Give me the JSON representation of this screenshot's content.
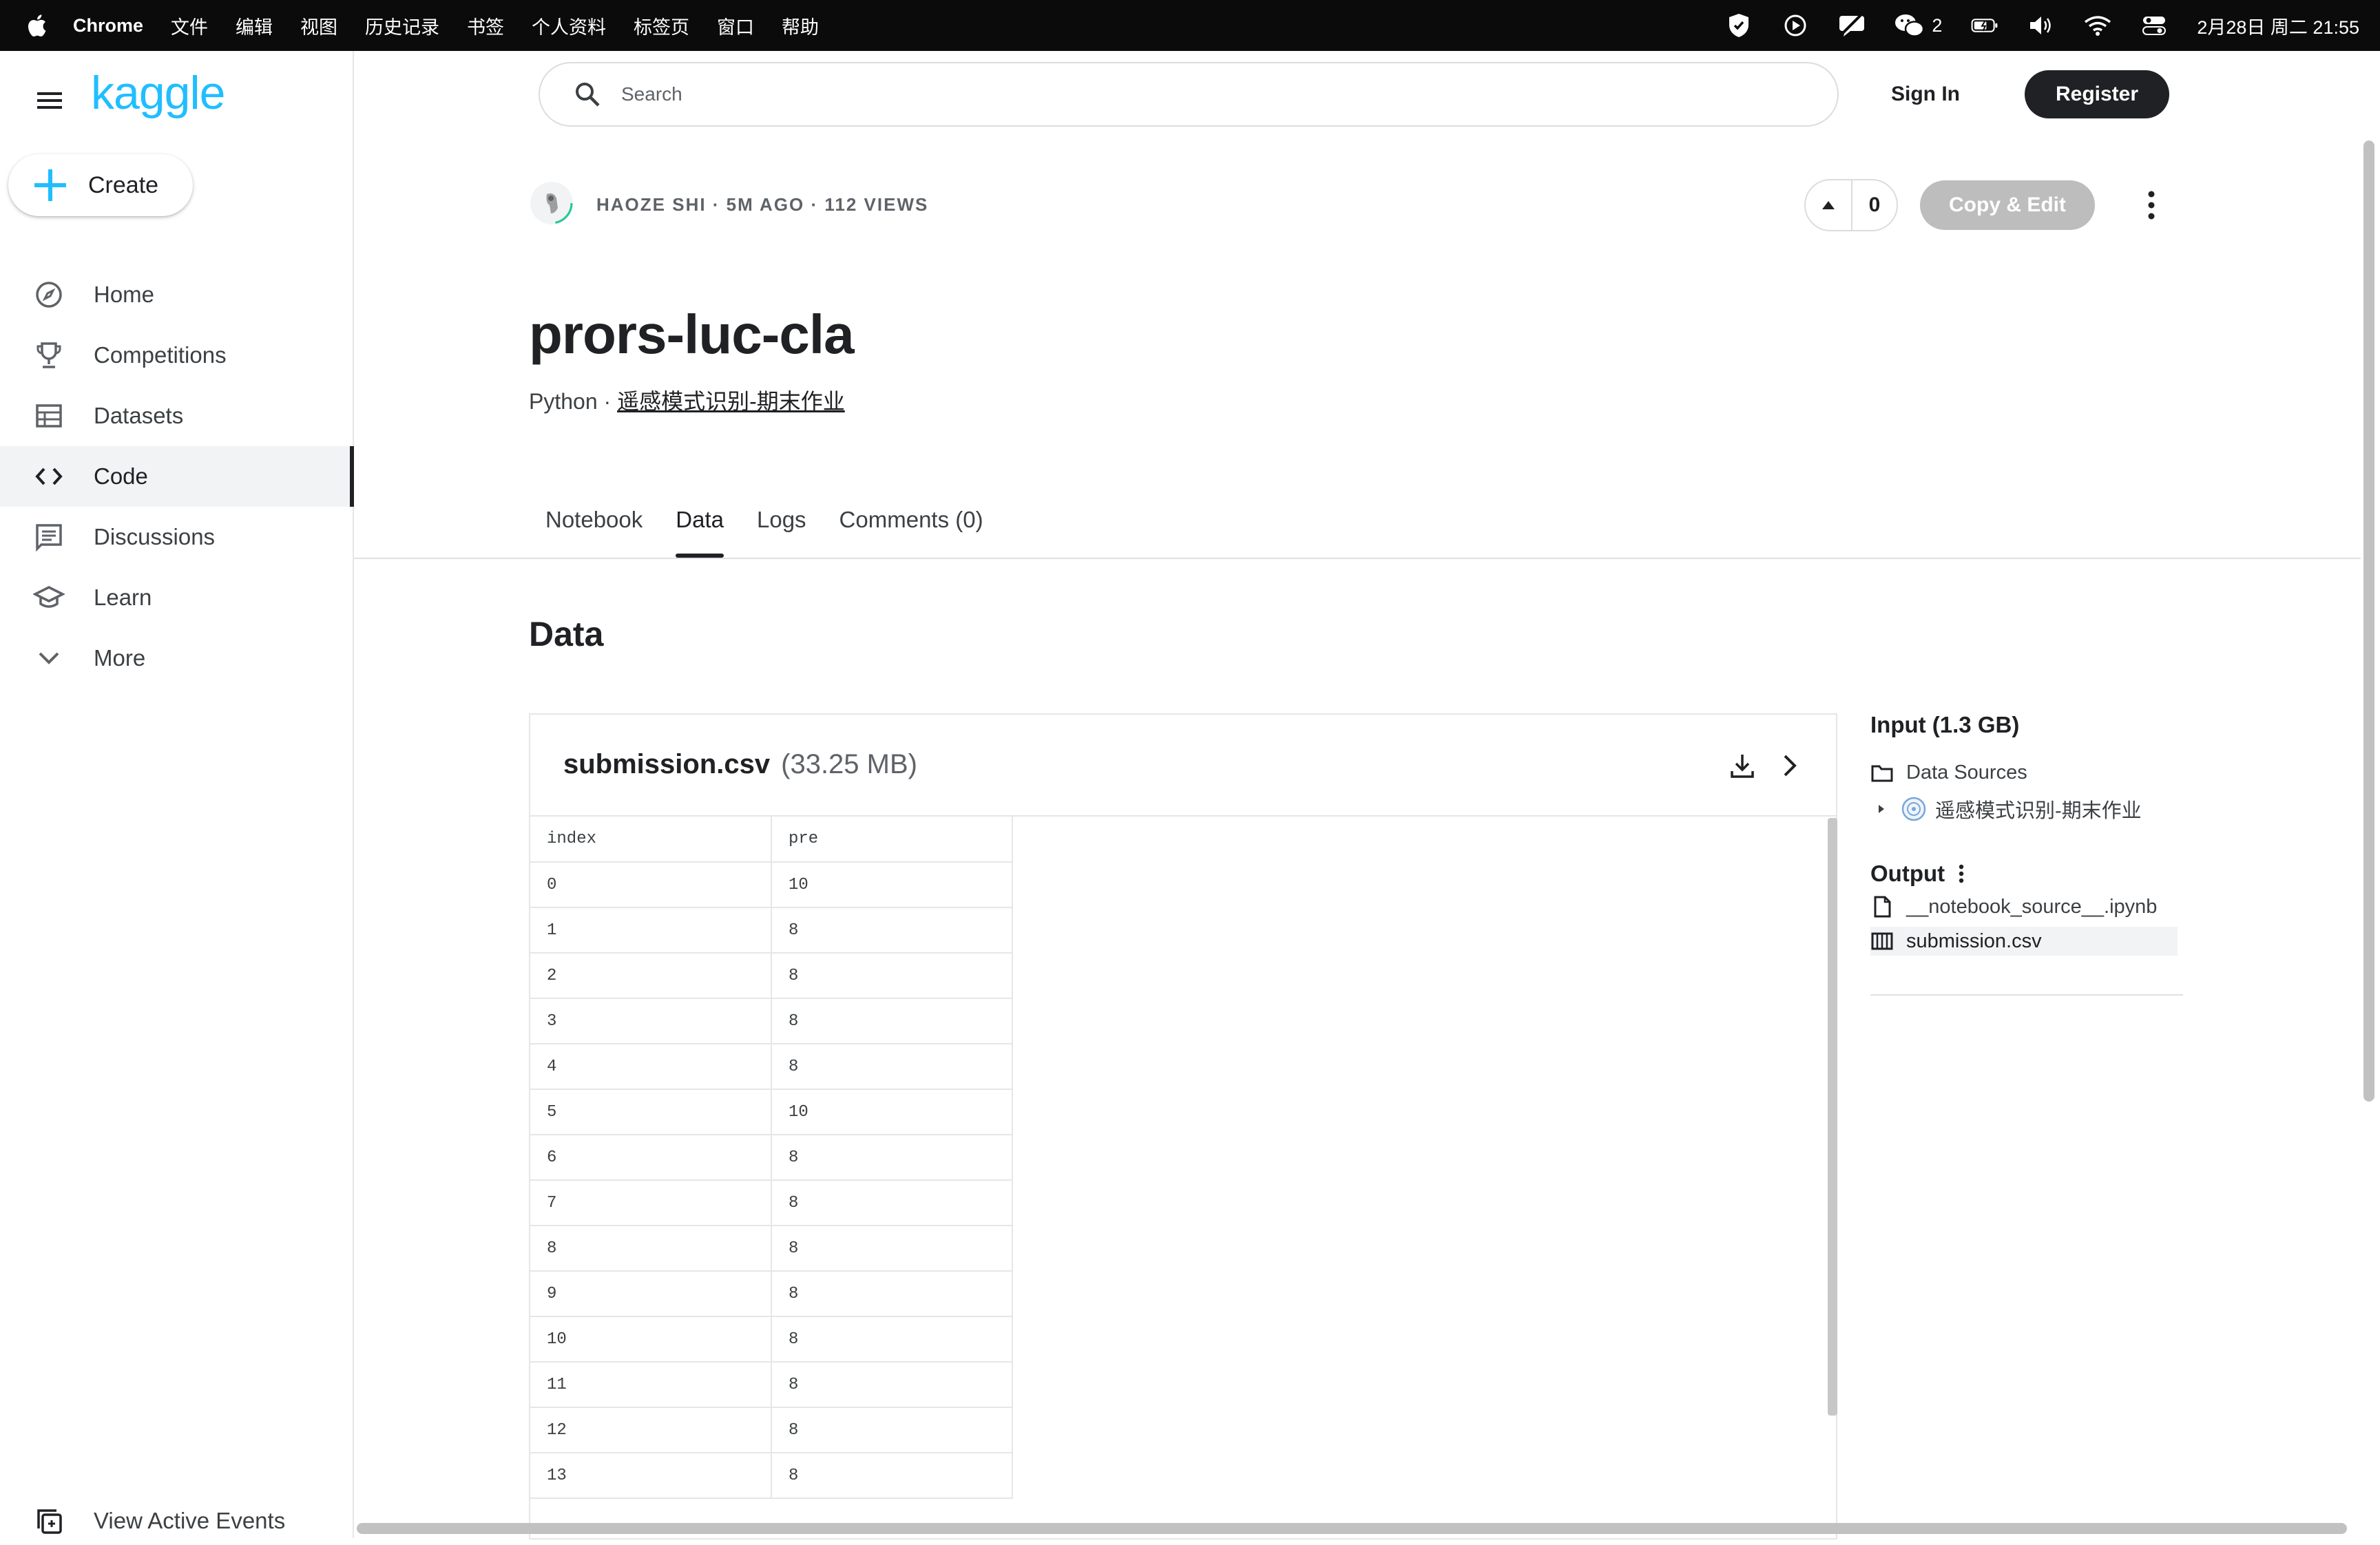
{
  "menubar": {
    "app": "Chrome",
    "items": [
      "文件",
      "编辑",
      "视图",
      "历史记录",
      "书签",
      "个人资料",
      "标签页",
      "窗口",
      "帮助"
    ],
    "wechat_count": "2",
    "datetime": "2月28日 周二 21:55"
  },
  "sidebar": {
    "logo": "kaggle",
    "create_label": "Create",
    "items": [
      {
        "label": "Home",
        "icon": "compass-icon"
      },
      {
        "label": "Competitions",
        "icon": "trophy-icon"
      },
      {
        "label": "Datasets",
        "icon": "table-icon"
      },
      {
        "label": "Code",
        "icon": "code-icon",
        "active": true
      },
      {
        "label": "Discussions",
        "icon": "discussion-icon"
      },
      {
        "label": "Learn",
        "icon": "school-icon"
      },
      {
        "label": "More",
        "icon": "chevron-down-icon"
      }
    ],
    "view_events": "View Active Events"
  },
  "header": {
    "search_placeholder": "Search",
    "sign_in": "Sign In",
    "register": "Register"
  },
  "notebook": {
    "meta": "HAOZE SHI · 5M AGO · 112 VIEWS",
    "votes": "0",
    "copy_edit": "Copy & Edit",
    "title": "prors-luc-cla",
    "language": "Python · ",
    "competition": "遥感模式识别-期末作业",
    "tabs": [
      "Notebook",
      "Data",
      "Logs",
      "Comments (0)"
    ],
    "active_tab": "Data"
  },
  "data": {
    "heading": "Data",
    "file_name": "submission.csv",
    "file_size": "(33.25 MB)",
    "columns": [
      "index",
      "pre"
    ],
    "rows": [
      [
        "0",
        "10"
      ],
      [
        "1",
        "8"
      ],
      [
        "2",
        "8"
      ],
      [
        "3",
        "8"
      ],
      [
        "4",
        "8"
      ],
      [
        "5",
        "10"
      ],
      [
        "6",
        "8"
      ],
      [
        "7",
        "8"
      ],
      [
        "8",
        "8"
      ],
      [
        "9",
        "8"
      ],
      [
        "10",
        "8"
      ],
      [
        "11",
        "8"
      ],
      [
        "12",
        "8"
      ],
      [
        "13",
        "8"
      ]
    ]
  },
  "io": {
    "input_heading": "Input (1.3 GB)",
    "data_sources": "Data Sources",
    "source_name": "遥感模式识别-期末作业",
    "output_heading": "Output",
    "output_files": [
      "__notebook_source__.ipynb",
      "submission.csv"
    ]
  },
  "colors": {
    "kaggle_blue": "#20beff",
    "dark": "#202124",
    "copy_edit_disabled": "#bdbdbd"
  }
}
